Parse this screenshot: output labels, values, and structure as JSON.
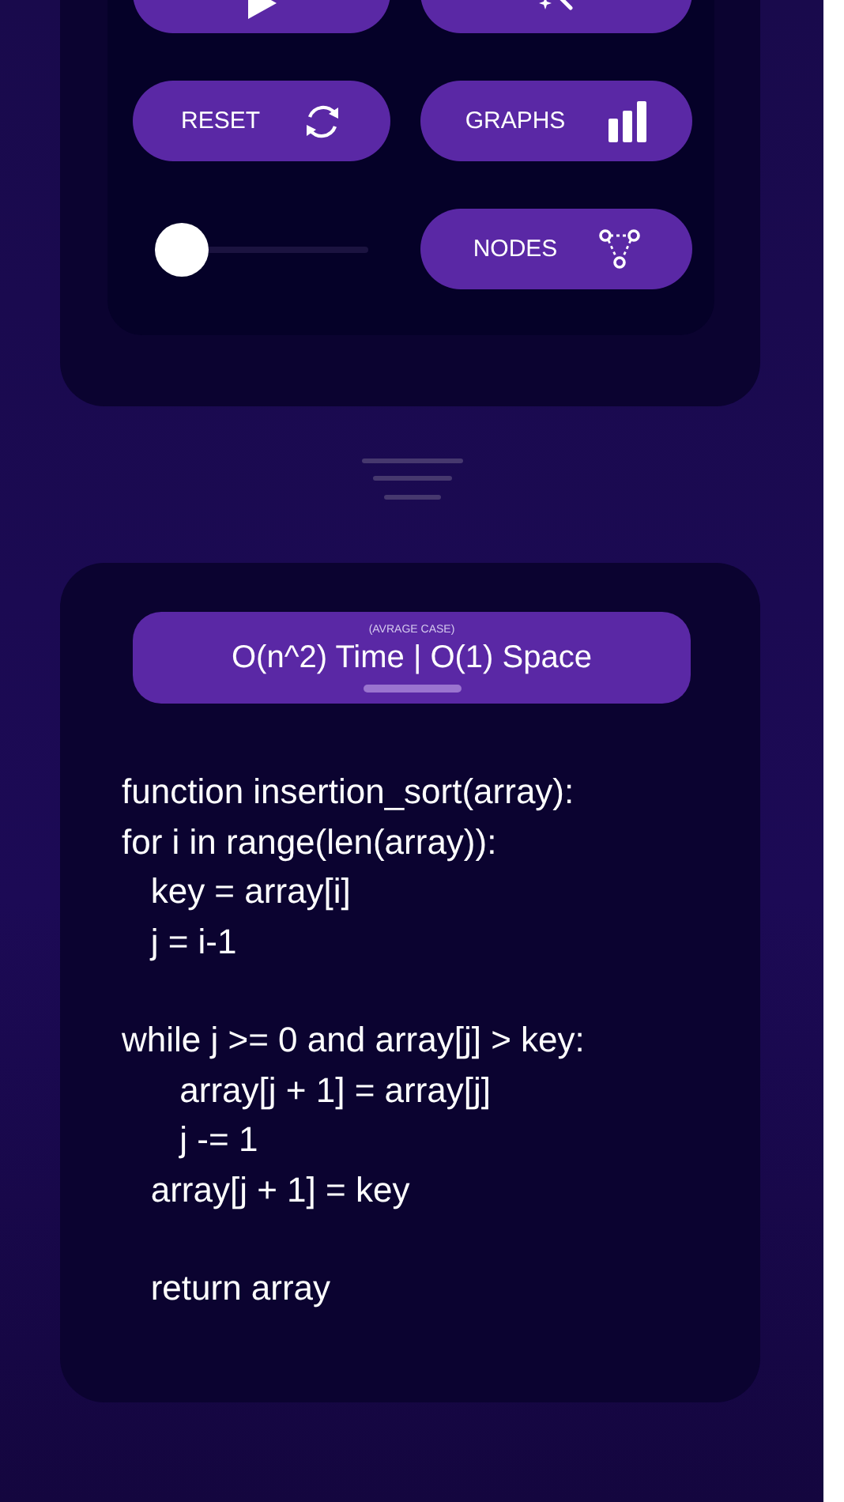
{
  "controls": {
    "buttons": [
      {
        "kind": "play"
      },
      {
        "kind": "wand"
      },
      {
        "label": "RESET",
        "kind": "refresh"
      },
      {
        "label": "GRAPHS",
        "kind": "bars"
      },
      {
        "label": "NODES",
        "kind": "nodes"
      }
    ],
    "slider": {
      "level": 0
    }
  },
  "complexity": {
    "caption": "(AVRAGE CASE)",
    "value": "O(n^2) Time | O(1) Space"
  },
  "code": {
    "blocks": [
      [
        "function insertion_sort(array):",
        "for i in range(len(array)):",
        "   key = array[i]",
        "   j = i-1"
      ],
      [
        "while j >= 0 and array[j] > key:",
        "      array[j + 1] = array[j]",
        "      j -= 1",
        "   array[j + 1] = key"
      ],
      [
        "   return array"
      ]
    ]
  }
}
